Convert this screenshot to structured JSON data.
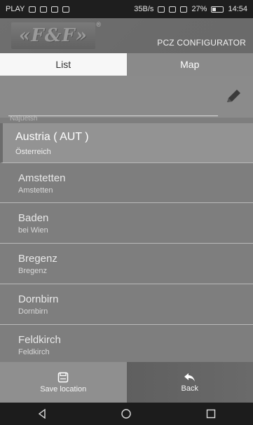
{
  "status_bar": {
    "carrier": "PLAY",
    "speed": "35B/s",
    "battery": "27%",
    "time": "14:54"
  },
  "header": {
    "logo": "«F&F»",
    "title": "PCZ CONFIGURATOR"
  },
  "tabs": [
    {
      "label": "List"
    },
    {
      "label": "Map"
    }
  ],
  "search": {
    "value": "",
    "placeholder": ""
  },
  "list": {
    "faded_label": "Najuetsh",
    "items": [
      {
        "title": "Austria ( AUT )",
        "subtitle": "Österreich"
      },
      {
        "title": "Amstetten",
        "subtitle": "Amstetten"
      },
      {
        "title": "Baden",
        "subtitle": "bei Wien"
      },
      {
        "title": "Bregenz",
        "subtitle": "Bregenz"
      },
      {
        "title": "Dornbirn",
        "subtitle": "Dornbirn"
      },
      {
        "title": "Feldkirch",
        "subtitle": "Feldkirch"
      }
    ]
  },
  "bottom": {
    "save_label": "Save location",
    "back_label": "Back"
  }
}
